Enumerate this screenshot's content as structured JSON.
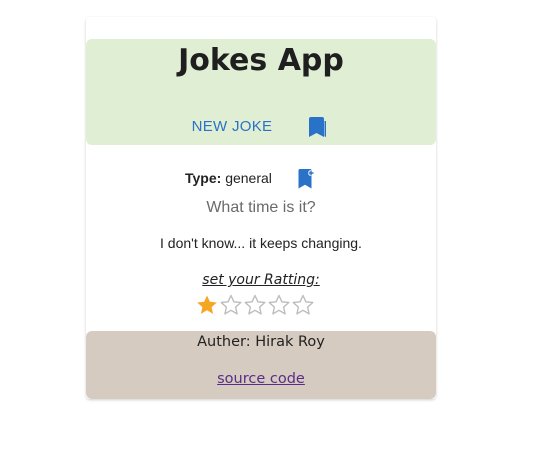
{
  "header": {
    "title": "Jokes App",
    "new_joke_label": "NEW JOKE",
    "bookmarks_icon": "bookmarks-icon"
  },
  "joke": {
    "type_label": "Type:",
    "type_value": "general",
    "add_bookmark_icon": "bookmark-add-icon",
    "setup": "What time is it?",
    "punchline": "I don't know... it keeps changing."
  },
  "rating": {
    "label": "set your Ratting:",
    "value": 1,
    "max": 5
  },
  "footer": {
    "author": "Auther: Hirak Roy",
    "source_link": "source code"
  },
  "colors": {
    "header_bg": "#e0eed4",
    "footer_bg": "#d6cbc0",
    "accent_blue": "#2a72c7",
    "star_filled": "#f5a623",
    "star_empty": "#bdbdbd",
    "link_visited": "#5a2c8a"
  }
}
